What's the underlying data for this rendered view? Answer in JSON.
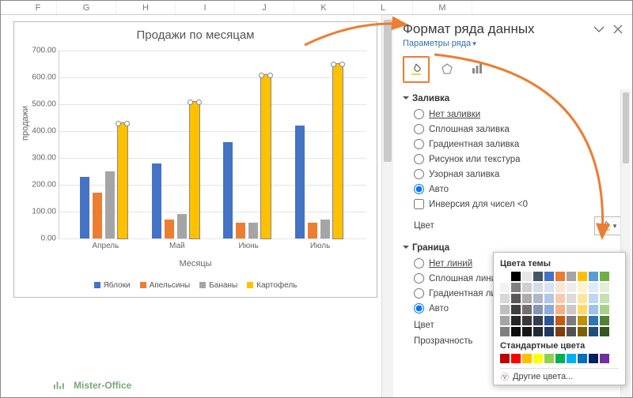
{
  "columns": [
    "F",
    "G",
    "H",
    "I",
    "J",
    "K",
    "L",
    "M"
  ],
  "chart_data": {
    "type": "bar",
    "title": "Продажи по месяцам",
    "xlabel": "Месяцы",
    "ylabel": "продажи",
    "ylim": [
      0,
      700
    ],
    "ystep": 100,
    "categories": [
      "Апрель",
      "Май",
      "Июнь",
      "Июль"
    ],
    "series": [
      {
        "name": "Яблоки",
        "color": "#4472C4",
        "values": [
          230,
          280,
          360,
          420
        ]
      },
      {
        "name": "Апельсины",
        "color": "#ED7D31",
        "values": [
          170,
          70,
          60,
          60
        ]
      },
      {
        "name": "Бананы",
        "color": "#A5A5A5",
        "values": [
          250,
          90,
          60,
          70
        ]
      },
      {
        "name": "Картофель",
        "color": "#FFC000",
        "values": [
          430,
          510,
          610,
          650
        ]
      }
    ],
    "selected_series": 3
  },
  "watermark": "Mister-Office",
  "pane": {
    "title": "Формат ряда данных",
    "subtitle": "Параметры ряда",
    "tabs": [
      "fill-icon",
      "effects-icon",
      "bars-icon"
    ],
    "fill": {
      "header": "Заливка",
      "options": {
        "none": "Нет заливки",
        "solid": "Сплошная заливка",
        "gradient": "Градиентная заливка",
        "picture": "Рисунок или текстура",
        "pattern": "Узорная заливка",
        "auto": "Авто"
      },
      "selected": "auto",
      "invert_label": "Инверсия для чисел <0",
      "color_label": "Цвет"
    },
    "border": {
      "header": "Граница",
      "options": {
        "none": "Нет линий",
        "solid": "Сплошная линия",
        "gradient": "Градиентная линия",
        "auto": "Авто"
      },
      "selected": "auto",
      "color_label": "Цвет",
      "transparency_label": "Прозрачность"
    }
  },
  "popup": {
    "theme_header": "Цвета темы",
    "theme_row": [
      "#ffffff",
      "#000000",
      "#e7e6e6",
      "#44546a",
      "#4472c4",
      "#ed7d31",
      "#a5a5a5",
      "#ffc000",
      "#5b9bd5",
      "#70ad47"
    ],
    "theme_tints": [
      [
        "#f2f2f2",
        "#7f7f7f",
        "#d0cece",
        "#d6dce4",
        "#d9e2f3",
        "#fbe5d5",
        "#ededed",
        "#fff2cc",
        "#deebf6",
        "#e2efd9"
      ],
      [
        "#d8d8d8",
        "#595959",
        "#aeabab",
        "#adb9ca",
        "#b4c6e7",
        "#f7cbac",
        "#dbdbdb",
        "#fee599",
        "#bdd7ee",
        "#c5e0b3"
      ],
      [
        "#bfbfbf",
        "#3f3f3f",
        "#757070",
        "#8496b0",
        "#8eaadb",
        "#f4b183",
        "#c9c9c9",
        "#ffd965",
        "#9cc3e5",
        "#a8d08d"
      ],
      [
        "#a5a5a5",
        "#262626",
        "#3a3838",
        "#323f4f",
        "#2f5496",
        "#c55a11",
        "#7b7b7b",
        "#bf9000",
        "#2e75b5",
        "#538135"
      ],
      [
        "#7f7f7f",
        "#0c0c0c",
        "#171616",
        "#222a35",
        "#1f3864",
        "#833c0b",
        "#525252",
        "#7f6000",
        "#1e4e79",
        "#375623"
      ]
    ],
    "std_header": "Стандартные цвета",
    "std_row": [
      "#c00000",
      "#ff0000",
      "#ffc000",
      "#ffff00",
      "#92d050",
      "#00b050",
      "#00b0f0",
      "#0070c0",
      "#002060",
      "#7030a0"
    ],
    "more": "Другие цвета..."
  }
}
